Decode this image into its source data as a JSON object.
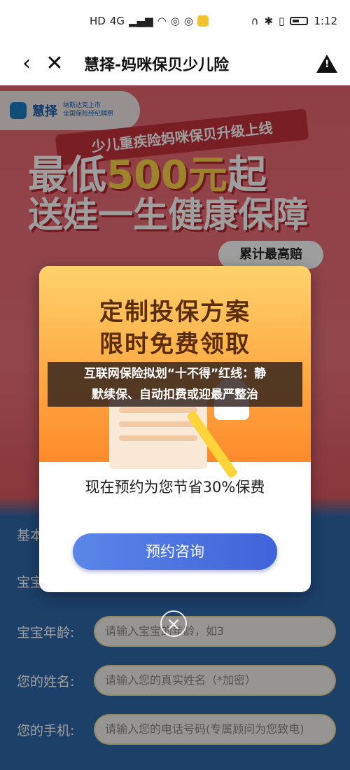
{
  "status_bar": {
    "left_signal": "4G",
    "time": "1:12"
  },
  "navbar": {
    "title": "慧择-妈咪保贝少儿险"
  },
  "background": {
    "brand_name": "慧择",
    "brand_sub_line1": "纳斯达克上市",
    "brand_sub_line2": "全国保险经纪牌照",
    "hero_subtitle": "少儿重疾险妈咪保贝升级上线",
    "hero_line1_a": "最低",
    "hero_line1_b": "500元",
    "hero_line1_c": "起",
    "hero_line2": "送娃一生健康保障",
    "badge": "累计最高赔",
    "form": {
      "fields": [
        {
          "label": "宝宝年龄:",
          "placeholder": "请输入宝宝的年龄，如3"
        },
        {
          "label": "您的姓名:",
          "placeholder": "请输入您的真实姓名（*加密）"
        },
        {
          "label": "您的手机:",
          "placeholder": "请输入您的电话号码(专属顾问为您致电)"
        }
      ],
      "partial_label_1": "基本",
      "partial_label_2": "宝宝"
    }
  },
  "modal": {
    "headline_1": "定制投保方案",
    "headline_2": "限时免费领取",
    "subtitle": "现在预约为您节省30%保费",
    "button_label": "预约咨询"
  },
  "caption": {
    "line1": "互联网保险拟划“十不得”红线：静",
    "line2": "默续保、自动扣费或迎最严整治"
  },
  "colors": {
    "primary_button": "#4a6fe0",
    "modal_header": "#ffb14a",
    "page_red": "#e7676f",
    "form_blue": "#2f68a8"
  }
}
